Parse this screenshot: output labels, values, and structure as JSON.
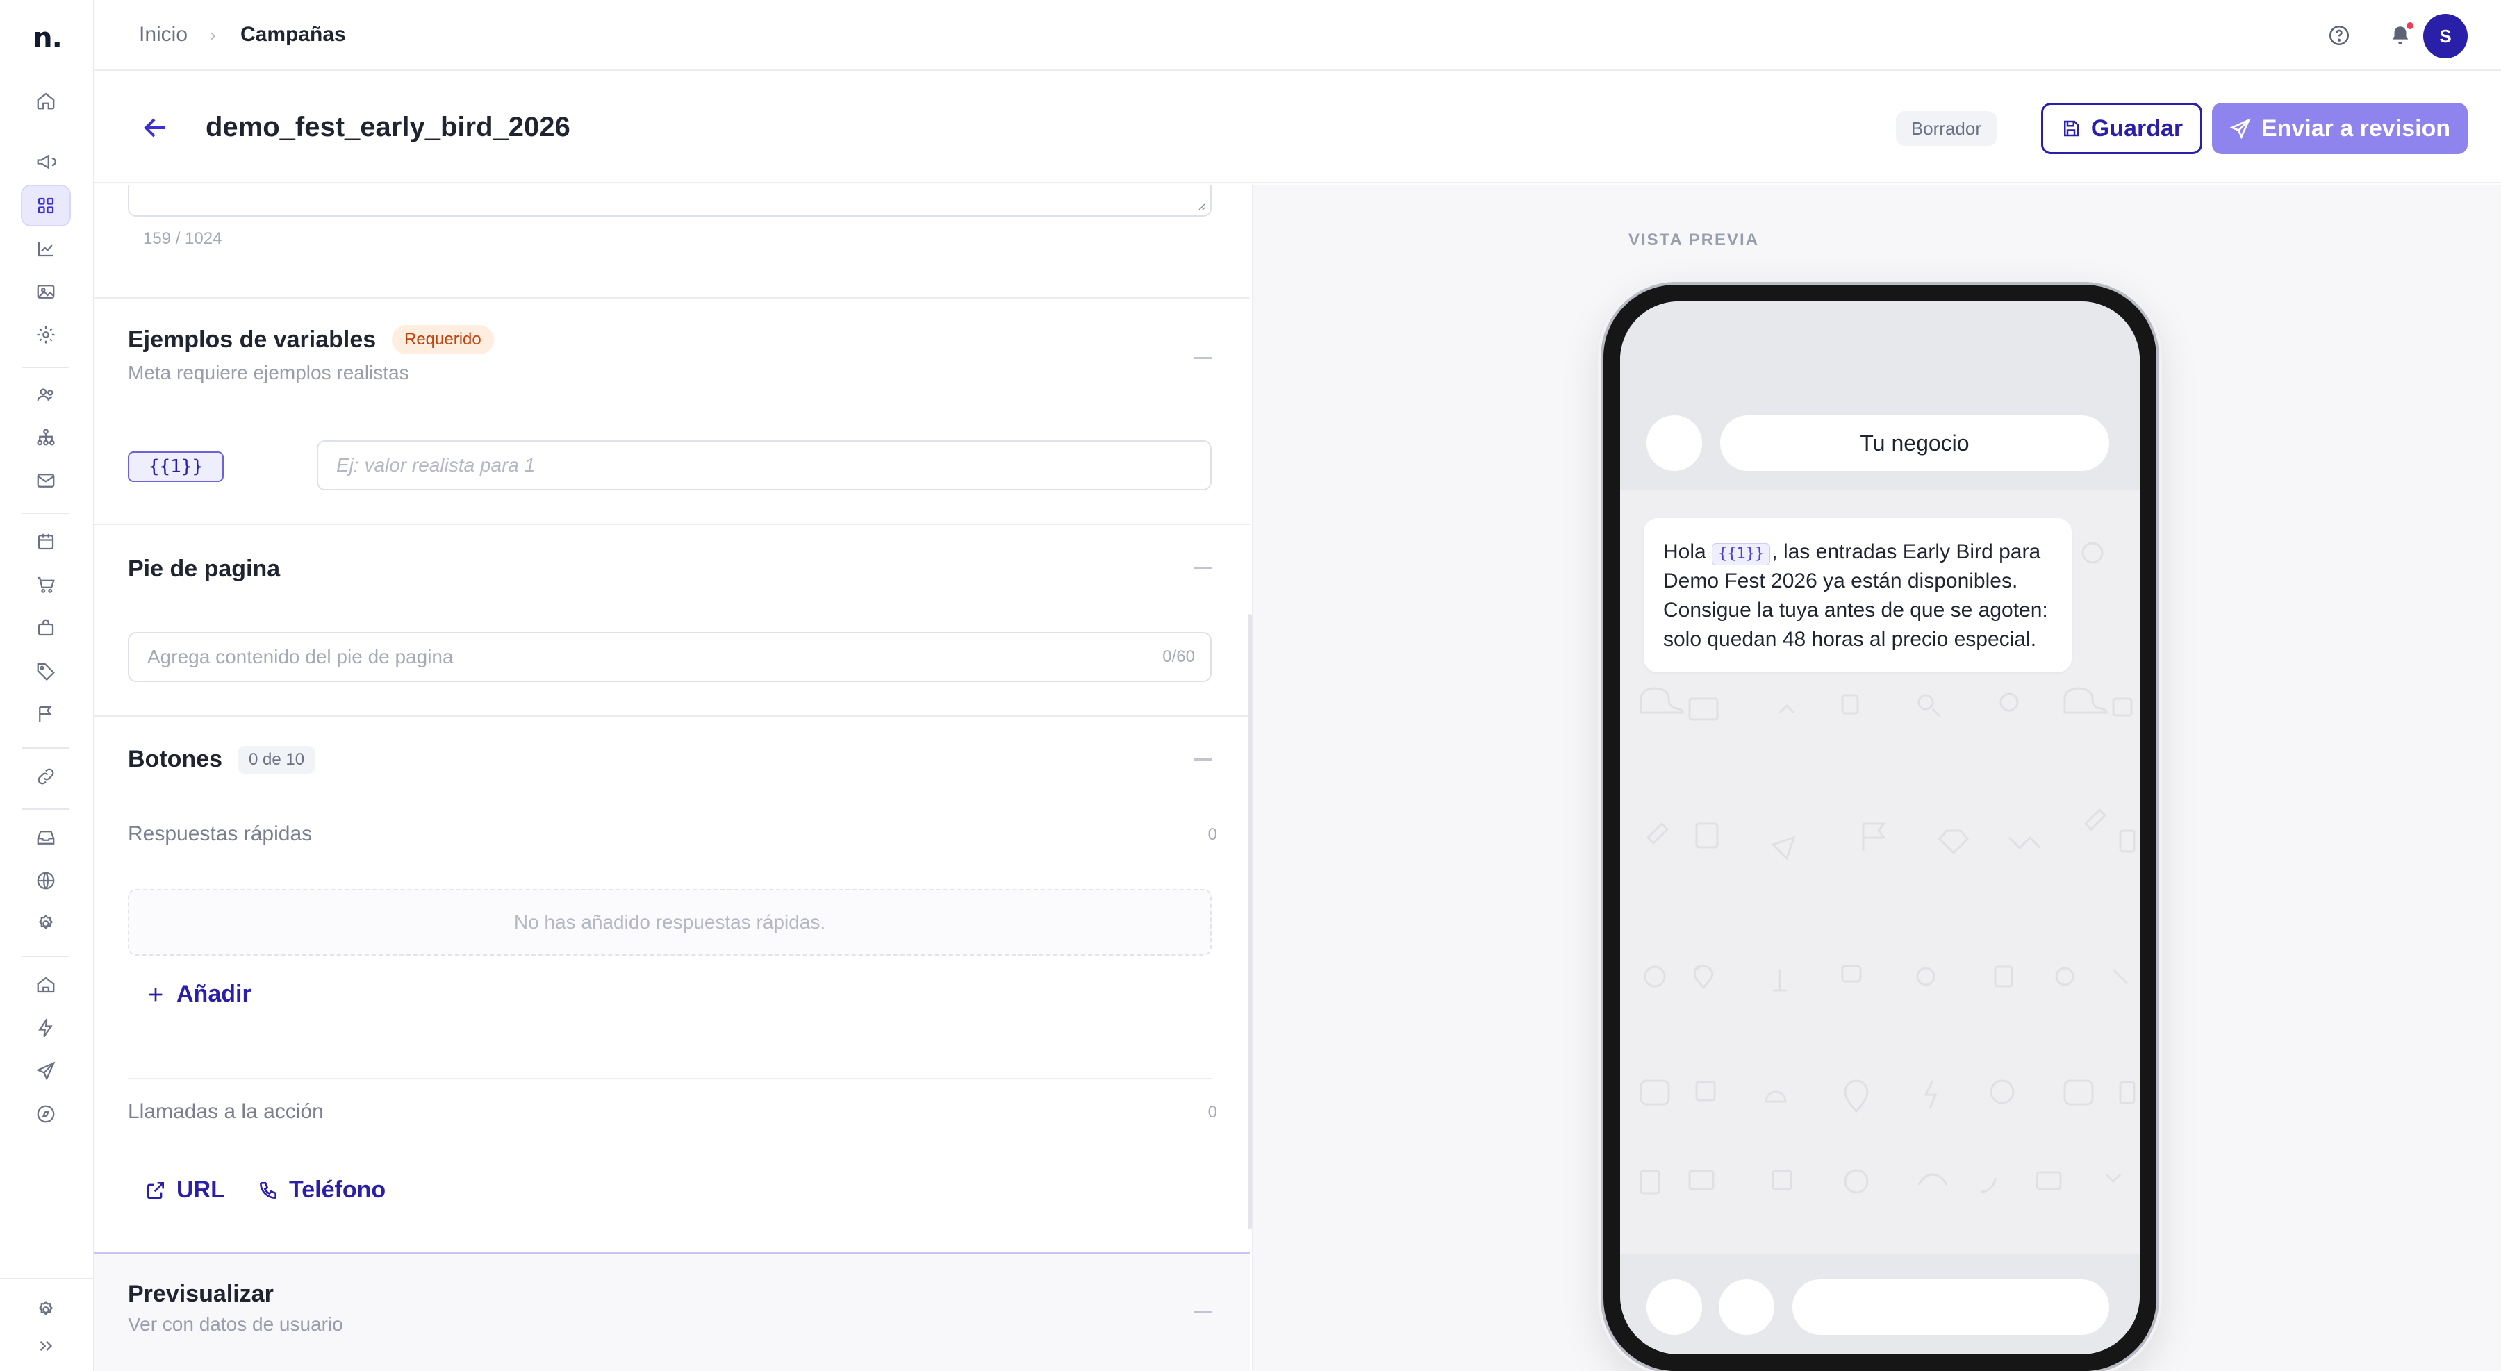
{
  "app": {
    "logo": "n."
  },
  "breadcrumb": {
    "home": "Inicio",
    "separator": "›",
    "current": "Campañas"
  },
  "header": {
    "title": "demo_fest_early_bird_2026",
    "status": "Borrador",
    "save_label": "Guardar",
    "send_label": "Enviar a revision"
  },
  "body_counter": "159 / 1024",
  "variables": {
    "title": "Ejemplos de variables",
    "badge": "Requerido",
    "subtitle": "Meta requiere ejemplos realistas",
    "chip": "{{1}}",
    "placeholder": "Ej: valor realista para 1"
  },
  "footer_section": {
    "title": "Pie de pagina",
    "placeholder": "Agrega contenido del pie de pagina",
    "count": "0/60"
  },
  "buttons_section": {
    "title": "Botones",
    "count": "0 de 10",
    "quick_replies_label": "Respuestas rápidas",
    "quick_replies_count": "0",
    "empty_text": "No has añadido respuestas rápidas.",
    "add_label": "Añadir",
    "cta_label": "Llamadas a la acción",
    "cta_count": "0",
    "url_label": "URL",
    "phone_label": "Teléfono"
  },
  "preview_section": {
    "title": "Previsualizar",
    "subtitle": "Ver con datos de usuario"
  },
  "phone_preview": {
    "label": "VISTA PREVIA",
    "business_name": "Tu negocio",
    "message_prefix": "Hola ",
    "message_var": "{{1}}",
    "message_rest": ", las entradas Early Bird para Demo Fest 2026 ya están disponibles. Consigue la tuya antes de que se agoten: solo quedan 48 horas al precio especial."
  },
  "user": {
    "initial": "S"
  },
  "colors": {
    "accent": "#2a1fa8",
    "accent_light": "#8f83ee",
    "required": "#c2410c"
  }
}
